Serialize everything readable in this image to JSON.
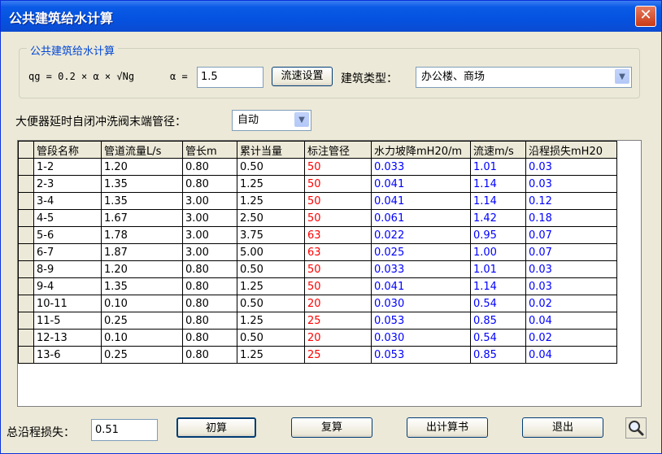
{
  "window": {
    "title": "公共建筑给水计算",
    "close_symbol": "✕"
  },
  "params": {
    "group_title": "公共建筑给水计算",
    "formula": "qg = 0.2 × α × √Ng",
    "alpha_label": "α =",
    "alpha_value": "1.5",
    "flow_setting_button": "流速设置",
    "building_type_label": "建筑类型：",
    "building_type_value": "办公楼、商场"
  },
  "pipe_option": {
    "label": "大便器延时自闭冲洗阀末端管径：",
    "value": "自动"
  },
  "table": {
    "headers": [
      "管段名称",
      "管道流量L/s",
      "管长m",
      "累计当量",
      "标注管径",
      "水力坡降mH20/m",
      "流速m/s",
      "沿程损失mH20"
    ],
    "rows": [
      [
        "1-2",
        "1.20",
        "0.80",
        "0.50",
        "50",
        "0.033",
        "1.01",
        "0.03"
      ],
      [
        "2-3",
        "1.35",
        "0.80",
        "1.25",
        "50",
        "0.041",
        "1.14",
        "0.03"
      ],
      [
        "3-4",
        "1.35",
        "3.00",
        "1.25",
        "50",
        "0.041",
        "1.14",
        "0.12"
      ],
      [
        "4-5",
        "1.67",
        "3.00",
        "2.50",
        "50",
        "0.061",
        "1.42",
        "0.18"
      ],
      [
        "5-6",
        "1.78",
        "3.00",
        "3.75",
        "63",
        "0.022",
        "0.95",
        "0.07"
      ],
      [
        "6-7",
        "1.87",
        "3.00",
        "5.00",
        "63",
        "0.025",
        "1.00",
        "0.07"
      ],
      [
        "8-9",
        "1.20",
        "0.80",
        "0.50",
        "50",
        "0.033",
        "1.01",
        "0.03"
      ],
      [
        "9-4",
        "1.35",
        "0.80",
        "1.25",
        "50",
        "0.041",
        "1.14",
        "0.03"
      ],
      [
        "10-11",
        "0.10",
        "0.80",
        "0.50",
        "20",
        "0.030",
        "0.54",
        "0.02"
      ],
      [
        "11-5",
        "0.25",
        "0.80",
        "1.25",
        "25",
        "0.053",
        "0.85",
        "0.04"
      ],
      [
        "12-13",
        "0.10",
        "0.80",
        "0.50",
        "20",
        "0.030",
        "0.54",
        "0.02"
      ],
      [
        "13-6",
        "0.25",
        "0.80",
        "1.25",
        "25",
        "0.053",
        "0.85",
        "0.04"
      ]
    ]
  },
  "footer": {
    "total_loss_label": "总沿程损失：",
    "total_loss_value": "0.51",
    "buttons": {
      "initial": "初算",
      "recalc": "复算",
      "report": "出计算书",
      "exit": "退出"
    },
    "search_icon": "magnifier-icon"
  },
  "colors": {
    "diameter": "#ff0000",
    "hydraulic": "#0000ff",
    "title_bar": "#0552e0"
  }
}
